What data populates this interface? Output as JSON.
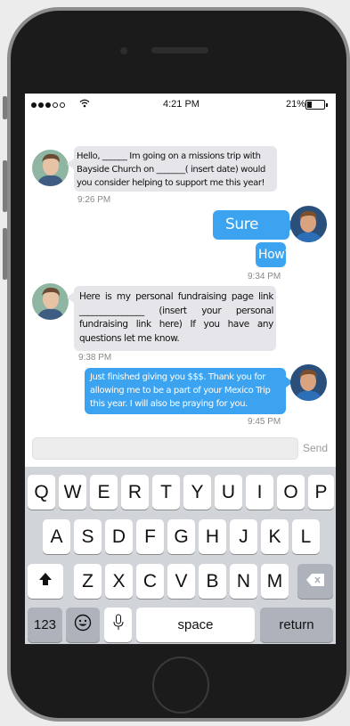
{
  "status_bar": {
    "time": "4:21 PM",
    "battery": "21%"
  },
  "messages": [
    {
      "sender": "incoming",
      "text": "Hello, ______ Im going on a missions trip with Bayside Church on _______( insert date) would you consider helping to support me this year!",
      "time": "9:26 PM"
    },
    {
      "sender": "outgoing",
      "text": "Sure"
    },
    {
      "sender": "outgoing",
      "text": "How?",
      "time": "9:34 PM"
    },
    {
      "sender": "incoming",
      "text": "Here is my personal fundraising page link _______________ (insert your personal fundraising link here) If you have any questions let me know.",
      "time": "9:38 PM"
    },
    {
      "sender": "outgoing",
      "text": "Just finished giving you $$$.  Thank you for allowing me to be a part of your Mexico Trip this year. I will also be praying for you.",
      "time": "9:45 PM"
    }
  ],
  "compose": {
    "placeholder": "",
    "send_label": "Send"
  },
  "keyboard": {
    "row1": [
      "Q",
      "W",
      "E",
      "R",
      "T",
      "Y",
      "U",
      "I",
      "O",
      "P"
    ],
    "row2": [
      "A",
      "S",
      "D",
      "F",
      "G",
      "H",
      "J",
      "K",
      "L"
    ],
    "row3": [
      "Z",
      "X",
      "C",
      "V",
      "B",
      "N",
      "M"
    ],
    "numbers_label": "123",
    "space_label": "space",
    "return_label": "return"
  },
  "icons": {
    "shift": "shift-icon",
    "delete": "delete-icon",
    "emoji": "emoji-icon",
    "mic": "microphone-icon"
  },
  "colors": {
    "outgoing_bubble": "#3ba3f0",
    "incoming_bubble": "#e5e5ea",
    "keyboard_bg": "#d1d4d9"
  }
}
